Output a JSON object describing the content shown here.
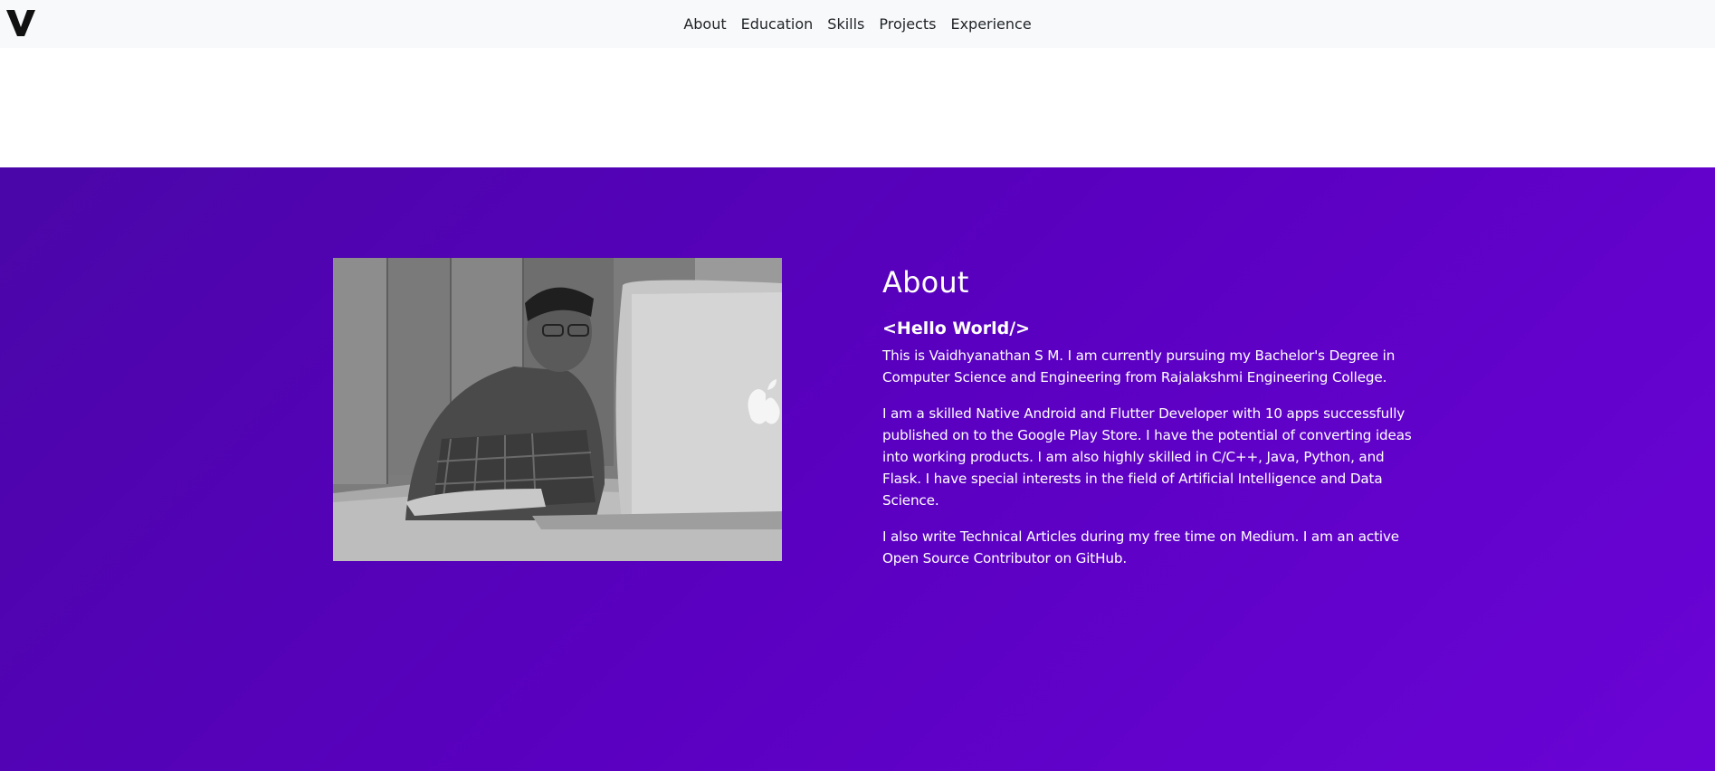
{
  "brand": {
    "logo_icon": "v-logo-icon"
  },
  "nav": {
    "items": [
      {
        "label": "About"
      },
      {
        "label": "Education"
      },
      {
        "label": "Skills"
      },
      {
        "label": "Projects"
      },
      {
        "label": "Experience"
      }
    ]
  },
  "about": {
    "title": "About",
    "subtitle": "<Hello World/>",
    "paragraphs": [
      "This is Vaidhyanathan S M. I am currently pursuing my Bachelor's Degree in Computer Science and Engineering from Rajalakshmi Engineering College.",
      "I am a skilled Native Android and Flutter Developer with 10 apps successfully published on to the Google Play Store. I have the potential of converting ideas into working products. I am also highly skilled in C/C++, Java, Python, and Flask. I have special interests in the field of Artificial Intelligence and Data Science.",
      "I also write Technical Articles during my free time on Medium. I am an active Open Source Contributor on GitHub."
    ],
    "photo_icon": "profile-photo"
  },
  "colors": {
    "navbar_bg": "#f8f9fa",
    "section_gradient_start": "#4a06a8",
    "section_gradient_end": "#6a04d6",
    "text_light": "#ffffff",
    "nav_text": "#212529"
  }
}
